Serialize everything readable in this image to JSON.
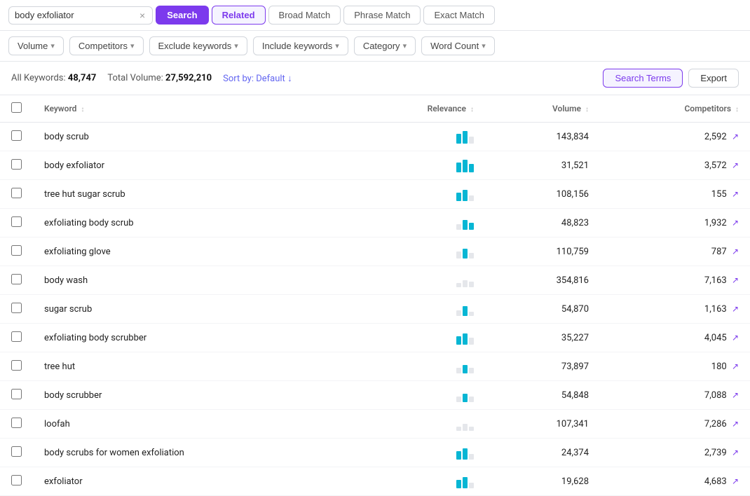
{
  "topBar": {
    "searchValue": "body exfoliator",
    "clearLabel": "×",
    "searchLabel": "Search",
    "tabs": [
      {
        "id": "related",
        "label": "Related",
        "active": true
      },
      {
        "id": "broad-match",
        "label": "Broad Match",
        "active": false
      },
      {
        "id": "phrase-match",
        "label": "Phrase Match",
        "active": false
      },
      {
        "id": "exact-match",
        "label": "Exact Match",
        "active": false
      }
    ]
  },
  "filterBar": {
    "filters": [
      {
        "id": "volume",
        "label": "Volume",
        "hasArrow": true
      },
      {
        "id": "competitors",
        "label": "Competitors",
        "hasArrow": true
      },
      {
        "id": "exclude-keywords",
        "label": "Exclude keywords",
        "hasArrow": true
      },
      {
        "id": "include-keywords",
        "label": "Include keywords",
        "hasArrow": true
      },
      {
        "id": "category",
        "label": "Category",
        "hasArrow": true
      },
      {
        "id": "word-count",
        "label": "Word Count",
        "hasArrow": true
      }
    ]
  },
  "resultsBar": {
    "allKeywordsLabel": "All Keywords:",
    "allKeywordsCount": "48,747",
    "totalVolumeLabel": "Total Volume:",
    "totalVolumeCount": "27,592,210",
    "sortLabel": "Sort by:",
    "sortValue": "Default",
    "searchTermsLabel": "Search Terms",
    "exportLabel": "Export"
  },
  "table": {
    "columns": [
      {
        "id": "keyword",
        "label": "Keyword",
        "sortable": true
      },
      {
        "id": "relevance",
        "label": "Relevance",
        "sortable": true
      },
      {
        "id": "volume",
        "label": "Volume",
        "sortable": true
      },
      {
        "id": "competitors",
        "label": "Competitors",
        "sortable": true
      }
    ],
    "rows": [
      {
        "keyword": "body scrub",
        "relevance": [
          {
            "height": 14,
            "color": "#06b6d4"
          },
          {
            "height": 18,
            "color": "#06b6d4"
          },
          {
            "height": 10,
            "color": "#e5e7eb"
          }
        ],
        "volume": "143,834",
        "competitors": "2,592"
      },
      {
        "keyword": "body exfoliator",
        "relevance": [
          {
            "height": 14,
            "color": "#06b6d4"
          },
          {
            "height": 18,
            "color": "#06b6d4"
          },
          {
            "height": 12,
            "color": "#06b6d4"
          }
        ],
        "volume": "31,521",
        "competitors": "3,572"
      },
      {
        "keyword": "tree hut sugar scrub",
        "relevance": [
          {
            "height": 12,
            "color": "#06b6d4"
          },
          {
            "height": 16,
            "color": "#06b6d4"
          },
          {
            "height": 8,
            "color": "#e5e7eb"
          }
        ],
        "volume": "108,156",
        "competitors": "155"
      },
      {
        "keyword": "exfoliating body scrub",
        "relevance": [
          {
            "height": 8,
            "color": "#e5e7eb"
          },
          {
            "height": 14,
            "color": "#06b6d4"
          },
          {
            "height": 10,
            "color": "#06b6d4"
          }
        ],
        "volume": "48,823",
        "competitors": "1,932"
      },
      {
        "keyword": "exfoliating glove",
        "relevance": [
          {
            "height": 10,
            "color": "#e5e7eb"
          },
          {
            "height": 14,
            "color": "#06b6d4"
          },
          {
            "height": 8,
            "color": "#e5e7eb"
          }
        ],
        "volume": "110,759",
        "competitors": "787"
      },
      {
        "keyword": "body wash",
        "relevance": [
          {
            "height": 6,
            "color": "#e5e7eb"
          },
          {
            "height": 10,
            "color": "#e5e7eb"
          },
          {
            "height": 8,
            "color": "#e5e7eb"
          }
        ],
        "volume": "354,816",
        "competitors": "7,163"
      },
      {
        "keyword": "sugar scrub",
        "relevance": [
          {
            "height": 8,
            "color": "#e5e7eb"
          },
          {
            "height": 14,
            "color": "#06b6d4"
          },
          {
            "height": 6,
            "color": "#e5e7eb"
          }
        ],
        "volume": "54,870",
        "competitors": "1,163"
      },
      {
        "keyword": "exfoliating body scrubber",
        "relevance": [
          {
            "height": 12,
            "color": "#06b6d4"
          },
          {
            "height": 16,
            "color": "#06b6d4"
          },
          {
            "height": 10,
            "color": "#e5e7eb"
          }
        ],
        "volume": "35,227",
        "competitors": "4,045"
      },
      {
        "keyword": "tree hut",
        "relevance": [
          {
            "height": 8,
            "color": "#e5e7eb"
          },
          {
            "height": 12,
            "color": "#06b6d4"
          },
          {
            "height": 8,
            "color": "#e5e7eb"
          }
        ],
        "volume": "73,897",
        "competitors": "180"
      },
      {
        "keyword": "body scrubber",
        "relevance": [
          {
            "height": 8,
            "color": "#e5e7eb"
          },
          {
            "height": 12,
            "color": "#06b6d4"
          },
          {
            "height": 8,
            "color": "#e5e7eb"
          }
        ],
        "volume": "54,848",
        "competitors": "7,088"
      },
      {
        "keyword": "loofah",
        "relevance": [
          {
            "height": 6,
            "color": "#e5e7eb"
          },
          {
            "height": 10,
            "color": "#e5e7eb"
          },
          {
            "height": 6,
            "color": "#e5e7eb"
          }
        ],
        "volume": "107,341",
        "competitors": "7,286"
      },
      {
        "keyword": "body scrubs for women exfoliation",
        "relevance": [
          {
            "height": 12,
            "color": "#06b6d4"
          },
          {
            "height": 16,
            "color": "#06b6d4"
          },
          {
            "height": 8,
            "color": "#e5e7eb"
          }
        ],
        "volume": "24,374",
        "competitors": "2,739"
      },
      {
        "keyword": "exfoliator",
        "relevance": [
          {
            "height": 12,
            "color": "#06b6d4"
          },
          {
            "height": 16,
            "color": "#06b6d4"
          },
          {
            "height": 8,
            "color": "#e5e7eb"
          }
        ],
        "volume": "19,628",
        "competitors": "4,683"
      }
    ]
  }
}
